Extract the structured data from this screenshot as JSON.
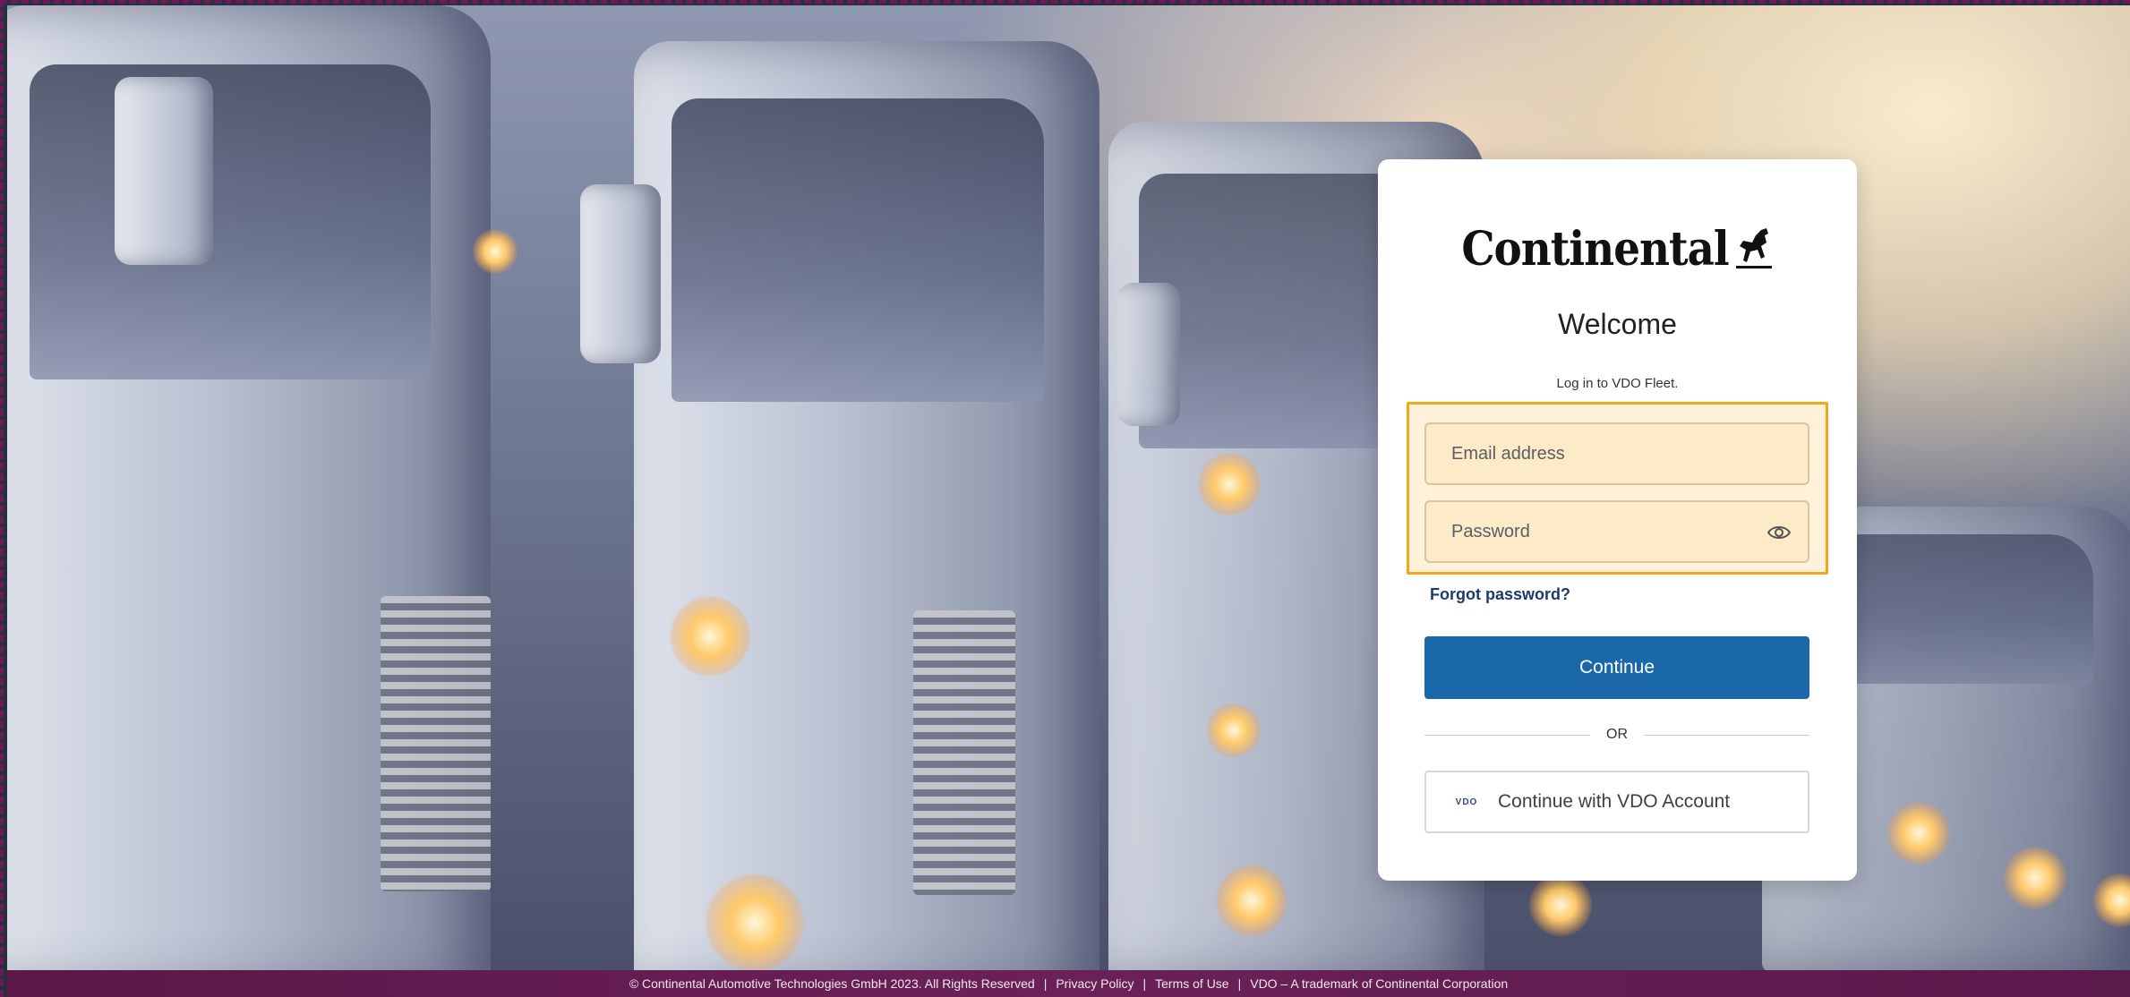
{
  "login": {
    "brand": "Continental",
    "title": "Welcome",
    "subtitle": "Log in to VDO Fleet.",
    "email_placeholder": "Email address",
    "password_placeholder": "Password",
    "forgot_password": "Forgot password?",
    "continue_label": "Continue",
    "or_label": "OR",
    "vdo_logo_text": "VDO",
    "vdo_account_label": "Continue with VDO Account"
  },
  "icons": {
    "password_toggle": "eye-icon",
    "brand_mark": "horse-icon"
  },
  "colors": {
    "primary_button": "#1a67aa",
    "highlight_border": "#f2a81a",
    "footer_bg": "#6b2158"
  },
  "footer": {
    "copyright": "© Continental Automotive Technologies GmbH 2023. All Rights Reserved",
    "privacy": "Privacy Policy",
    "terms": "Terms of Use",
    "trademark": "VDO – A trademark of Continental Corporation"
  }
}
